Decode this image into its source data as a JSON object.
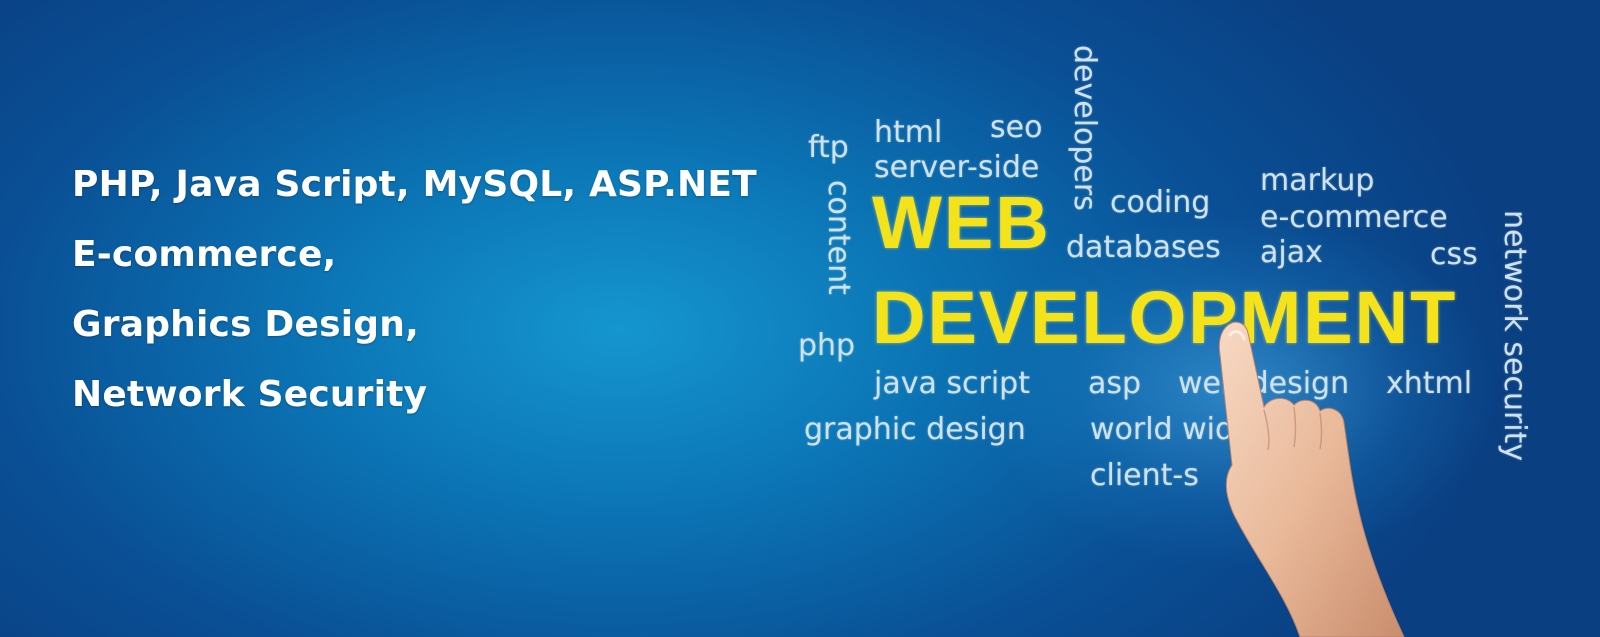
{
  "services": [
    "PHP, Java Script, MySQL, ASP.NET",
    "E-commerce,",
    "Graphics Design,",
    "Network Security"
  ],
  "cloud": {
    "headline_1": "WEB",
    "headline_2": "DEVELOPMENT",
    "words": {
      "ftp": "ftp",
      "html": "html",
      "seo": "seo",
      "server_side": "server-side",
      "content": "content",
      "developers": "developers",
      "coding": "coding",
      "databases": "databases",
      "markup": "markup",
      "e_commerce": "e-commerce",
      "ajax": "ajax",
      "css": "css",
      "network_security": "network security",
      "php": "php",
      "java_script": "java script",
      "asp": "asp",
      "web_design": "web design",
      "xhtml": "xhtml",
      "graphic_design": "graphic design",
      "world_wide_web": "world wide web",
      "client_side": "client-s"
    },
    "headline_color": "#f4e21b",
    "word_color": "#cfe3ef"
  },
  "colors": {
    "background": "#0b74b4",
    "text": "#ffffff"
  }
}
